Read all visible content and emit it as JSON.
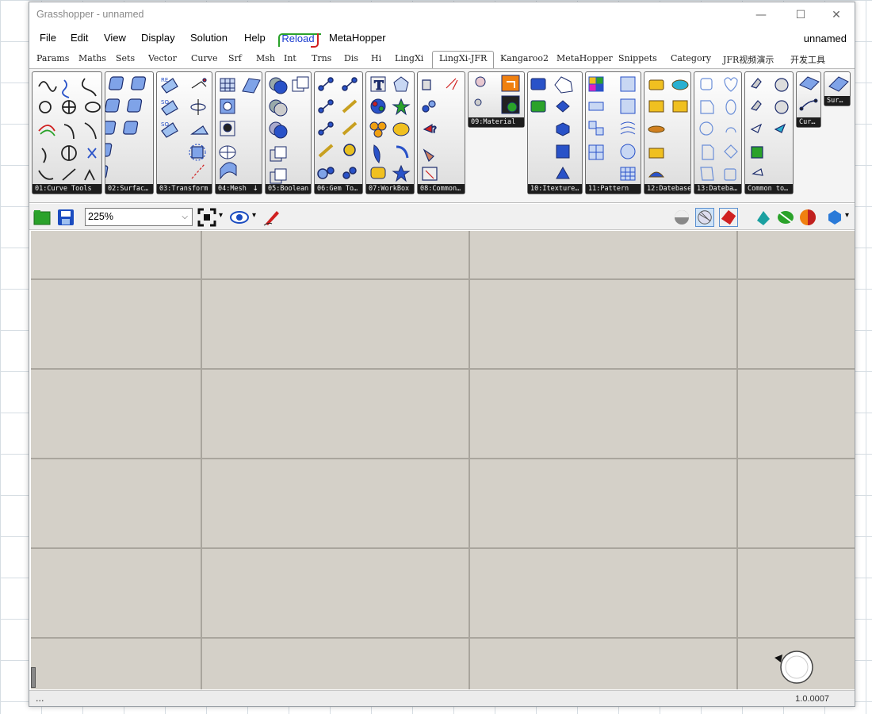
{
  "window": {
    "title": "Grasshopper - unnamed",
    "min": "—",
    "max": "☐",
    "close": "✕"
  },
  "menubar": {
    "items": [
      "File",
      "Edit",
      "View",
      "Display",
      "Solution",
      "Help"
    ],
    "reload": "Reload",
    "metahopper": "MetaHopper",
    "document_name": "unnamed"
  },
  "tabs": [
    "Params",
    "Maths",
    "Sets",
    "Vector",
    "Curve",
    "Srf",
    "Msh",
    "Int",
    "Trns",
    "Dis",
    "Hi",
    "LingXi",
    "LingXi-JFR",
    "Kangaroo2",
    "MetaHopper",
    "Snippets",
    "Category",
    "JFR视频演示",
    "开发工具"
  ],
  "active_tab": "LingXi-JFR",
  "panels": [
    "01:Curve Tools",
    "02:Surfac…",
    "03:Transform",
    "04:Mesh",
    "05:Boolean",
    "06:Gem To…",
    "07:WorkBox",
    "08:Common…",
    "09:Material",
    "10:Itexture…",
    "11:Pattern",
    "12:Datebase",
    "13:Dateba…",
    "Common to…",
    "Cur…",
    "Sur…"
  ],
  "mesh_panel_more": "↓",
  "toolbar": {
    "zoom": "225%",
    "zoom_arrow": "⌵",
    "dropdown_arrow": "▾"
  },
  "status": {
    "left": "...",
    "version": "1.0.0007"
  },
  "colors": {
    "canvas": "#d4d0c8",
    "grid": "#a9a59d",
    "ribbon_caption": "#1d1d1d",
    "accent_blue": "#2952c8"
  }
}
